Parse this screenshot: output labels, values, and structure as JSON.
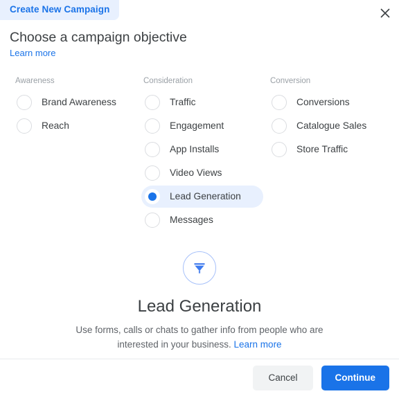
{
  "header": {
    "tab_label": "Create New Campaign",
    "close_icon": "close-icon",
    "title": "Choose a campaign objective",
    "learn_more": "Learn more"
  },
  "colors": {
    "accent": "#1a73e8",
    "accent_light": "#e8f0fe",
    "text": "#3c4043",
    "muted": "#9aa0a6",
    "border": "#dadce0"
  },
  "columns": [
    {
      "header": "Awareness",
      "options": [
        {
          "label": "Brand Awareness",
          "selected": false
        },
        {
          "label": "Reach",
          "selected": false
        }
      ]
    },
    {
      "header": "Consideration",
      "options": [
        {
          "label": "Traffic",
          "selected": false
        },
        {
          "label": "Engagement",
          "selected": false
        },
        {
          "label": "App Installs",
          "selected": false
        },
        {
          "label": "Video Views",
          "selected": false
        },
        {
          "label": "Lead Generation",
          "selected": true
        },
        {
          "label": "Messages",
          "selected": false
        }
      ]
    },
    {
      "header": "Conversion",
      "options": [
        {
          "label": "Conversions",
          "selected": false
        },
        {
          "label": "Catalogue Sales",
          "selected": false
        },
        {
          "label": "Store Traffic",
          "selected": false
        }
      ]
    }
  ],
  "detail": {
    "icon": "funnel-icon",
    "title": "Lead Generation",
    "description": "Use forms, calls or chats to gather info from people who are interested in your business.",
    "learn_more": "Learn more"
  },
  "footer": {
    "cancel_label": "Cancel",
    "continue_label": "Continue"
  }
}
